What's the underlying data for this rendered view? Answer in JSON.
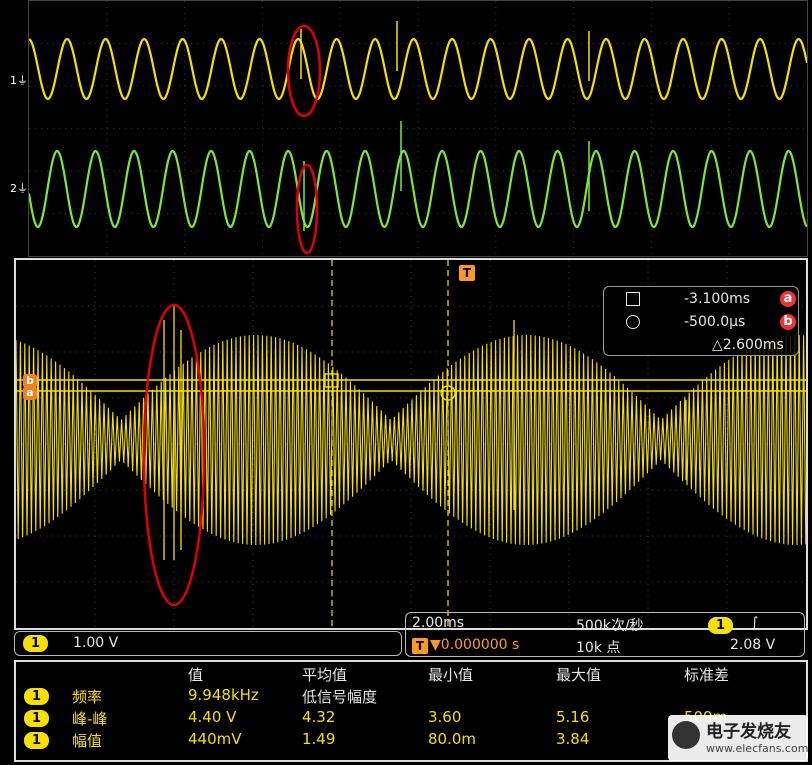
{
  "colors": {
    "ch1": "#f5e000",
    "ch2": "#7ee83a",
    "annotation": "#e00000",
    "trigger": "#ff9a1f",
    "badge": "#e33333"
  },
  "top": {
    "ch1_label": "1",
    "ch2_label": "2"
  },
  "main": {
    "trigger_marker": "T",
    "cursor_markers": {
      "a": "a",
      "b": "b"
    },
    "cursors": {
      "a_value": "-3.100ms",
      "a_badge": "a",
      "b_value": "-500.0µs",
      "b_badge": "b",
      "delta": "△2.600ms"
    }
  },
  "status": {
    "ch_badge": "1",
    "volts_div": "1.00 V",
    "time_div": "2.00ms",
    "trig_prefix": "T",
    "trig_offset": "▼0.000000 s",
    "sample_rate": "500k次/秒",
    "record_len": "10k 点",
    "trig_ch": "1",
    "trig_slope": "∫",
    "trig_level": "2.08 V"
  },
  "measurements": {
    "headers": [
      "值",
      "平均值",
      "最小值",
      "最大值",
      "标准差"
    ],
    "rows": [
      {
        "badge": "1",
        "name": "频率",
        "value": "9.948kHz",
        "mean": "低信号幅度",
        "min": "",
        "max": "",
        "std": ""
      },
      {
        "badge": "1",
        "name": "峰-峰",
        "value": "4.40 V",
        "mean": "4.32",
        "min": "3.60",
        "max": "5.16",
        "std": "509m"
      },
      {
        "badge": "1",
        "name": "幅值",
        "value": "440mV",
        "mean": "1.49",
        "min": "80.0m",
        "max": "3.84",
        "std": ""
      }
    ]
  },
  "watermark": {
    "text": "电子发烧友",
    "url": "www.elecfans.com"
  }
}
